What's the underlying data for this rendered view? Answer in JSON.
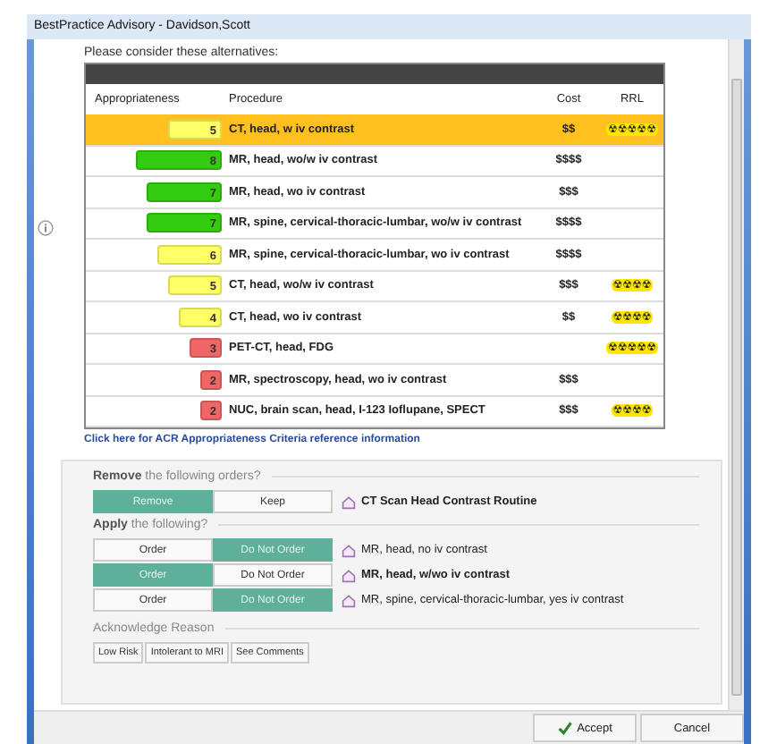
{
  "window": {
    "title": "BestPractice Advisory  - Davidson,Scott"
  },
  "intro": "Please consider these alternatives:",
  "table": {
    "columns": [
      "Appropriateness",
      "Procedure",
      "Cost",
      "RRL"
    ],
    "rows": [
      {
        "score": "5",
        "color": "#ffff66",
        "procedure": "CT, head, w iv contrast",
        "cost": "$$",
        "rrl": "☢☢☢☢☢",
        "selected": true
      },
      {
        "score": "8",
        "color": "#33cc11",
        "procedure": "MR, head, wo/w iv contrast",
        "cost": "$$$$",
        "selected": false
      },
      {
        "score": "7",
        "color": "#33cc11",
        "procedure": "MR, head, wo iv contrast",
        "cost": "$$$",
        "selected": false
      },
      {
        "score": "7",
        "color": "#33cc11",
        "procedure": "MR, spine, cervical-thoracic-lumbar, wo/w iv contrast",
        "cost": "$$$$",
        "selected": false
      },
      {
        "score": "6",
        "color": "#ffff66",
        "procedure": "MR, spine, cervical-thoracic-lumbar, wo iv contrast",
        "cost": "$$$$",
        "selected": false
      },
      {
        "score": "5",
        "color": "#ffff66",
        "procedure": "CT, head, wo/w iv contrast",
        "cost": "$$$",
        "rrl": "☢☢☢☢",
        "selected": false
      },
      {
        "score": "4",
        "color": "#ffff66",
        "procedure": "CT, head, wo iv contrast",
        "cost": "$$",
        "rrl": "☢☢☢☢",
        "selected": false
      },
      {
        "score": "3",
        "color": "#ee6666",
        "procedure": "PET-CT, head, FDG",
        "rrl": "☢☢☢☢☢",
        "selected": false
      },
      {
        "score": "2",
        "color": "#ee6666",
        "procedure": "MR, spectroscopy, head, wo iv contrast",
        "cost": "$$$",
        "selected": false
      },
      {
        "score": "2",
        "color": "#ee6666",
        "procedure": "NUC, brain scan, head, I-123 Ioflupane, SPECT",
        "cost": "$$$",
        "rrl": "☢☢☢☢",
        "selected": false
      }
    ]
  },
  "reference_link": "Click here for ACR Appropriateness Criteria reference information",
  "remove_section": {
    "heading_bold": "Remove",
    "heading": "the following orders?",
    "orders": [
      {
        "options": [
          {
            "label": "Remove",
            "selected": true
          },
          {
            "label": "Keep",
            "selected": false
          }
        ],
        "name": "CT Scan Head Contrast Routine",
        "bold": true
      }
    ]
  },
  "apply_section": {
    "heading_bold": "Apply",
    "heading": "the following?",
    "orders": [
      {
        "options": [
          {
            "label": "Order",
            "selected": false
          },
          {
            "label": "Do Not Order",
            "selected": true
          }
        ],
        "name": "MR, head, no iv contrast",
        "bold": false
      },
      {
        "options": [
          {
            "label": "Order",
            "selected": true
          },
          {
            "label": "Do Not Order",
            "selected": false
          }
        ],
        "name": "MR, head, w/wo iv contrast",
        "bold": true
      },
      {
        "options": [
          {
            "label": "Order",
            "selected": false
          },
          {
            "label": "Do Not Order",
            "selected": true
          }
        ],
        "name": "MR, spine, cervical-thoracic-lumbar, yes iv contrast",
        "bold": false
      }
    ]
  },
  "acknowledge": {
    "heading": "Acknowledge Reason",
    "buttons": [
      "Low Risk",
      "Intolerant to MRI",
      "See Comments"
    ]
  },
  "buttons": [
    {
      "label": "Accept",
      "kind": "accept"
    },
    {
      "label": "Cancel",
      "kind": "cancel"
    }
  ]
}
